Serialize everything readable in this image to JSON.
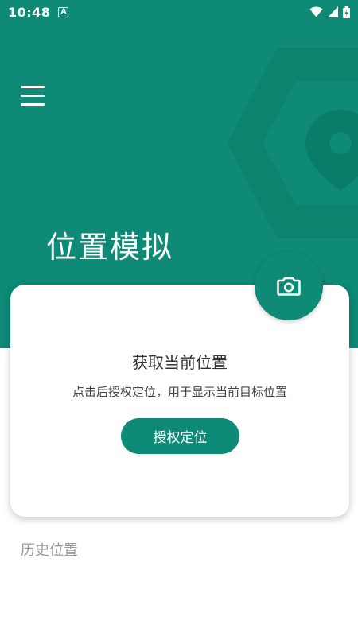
{
  "status_bar": {
    "time": "10:48",
    "notification_icon_letter": "A",
    "icons": [
      "wifi-icon",
      "signal-icon",
      "battery-icon"
    ]
  },
  "header": {
    "menu_icon": "hamburger-menu-icon",
    "title": "位置模拟",
    "decoration_icon": "location-pin-icon"
  },
  "card": {
    "title": "获取当前位置",
    "description": "点击后授权定位，用于显示当前目标位置",
    "button_label": "授权定位"
  },
  "fab": {
    "icon": "camera-icon"
  },
  "history": {
    "label": "历史位置"
  },
  "colors": {
    "primary": "#0e8a76",
    "background": "#ffffff",
    "muted_text": "#9a9a9a"
  }
}
